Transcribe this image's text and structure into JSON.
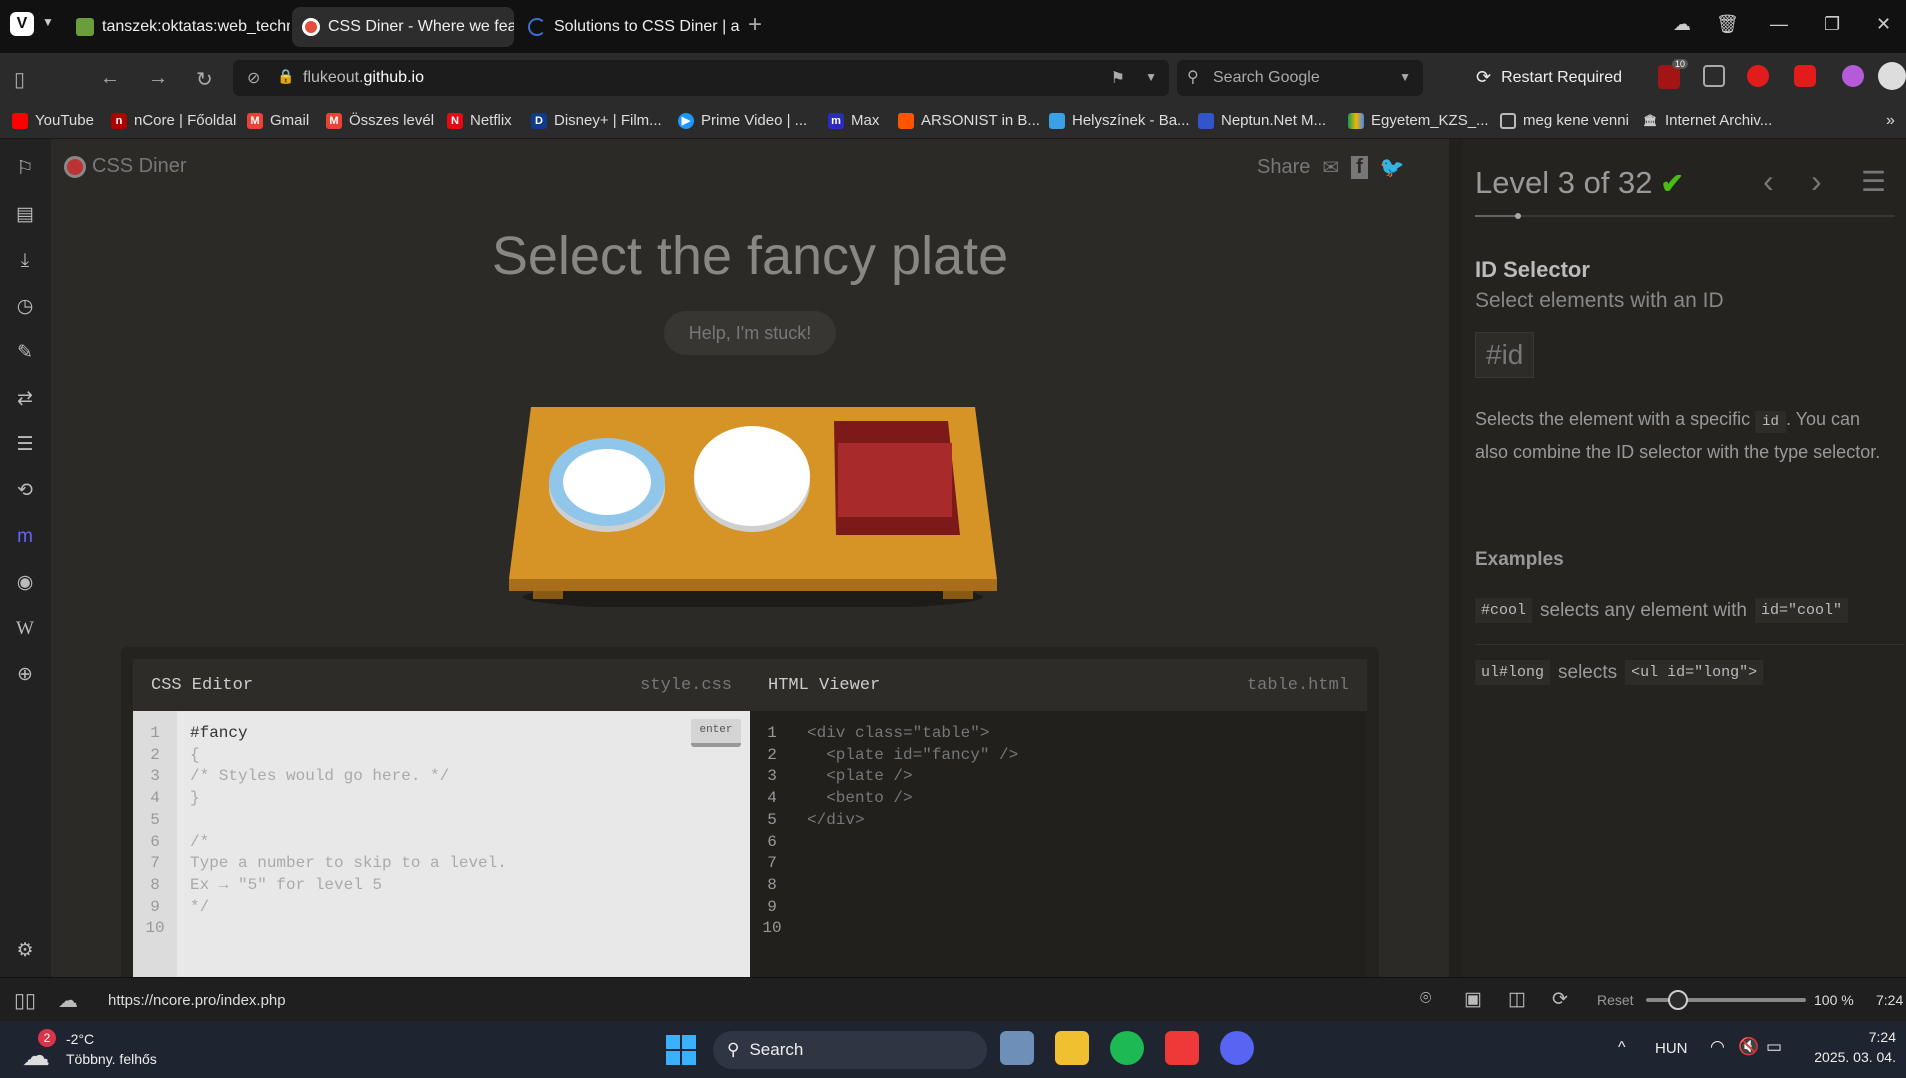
{
  "browser": {
    "tabs": [
      {
        "title": "tanszek:oktatas:web_technolo"
      },
      {
        "title": "CSS Diner - Where we feast"
      },
      {
        "title": "Solutions to CSS Diner | and"
      }
    ],
    "url_host": "flukeout.",
    "url_domain": "github.io",
    "search_placeholder": "Search Google",
    "restart_label": "Restart Required",
    "badge_count": "10",
    "bookmarks": [
      {
        "label": "YouTube",
        "color": "#ff0000"
      },
      {
        "label": "nCore | Főoldal",
        "color": "#b00000"
      },
      {
        "label": "Gmail",
        "color": "#ea4335"
      },
      {
        "label": "Összes levél",
        "color": "#ea4335"
      },
      {
        "label": "Netflix",
        "color": "#e50914"
      },
      {
        "label": "Disney+ | Film...",
        "color": "#0f3b8c"
      },
      {
        "label": "Prime Video | ...",
        "color": "#1a98ff"
      },
      {
        "label": "Max",
        "color": "#2b2bbf"
      },
      {
        "label": "ARSONIST in B...",
        "color": "#ff5500"
      },
      {
        "label": "Helyszínek - Ba...",
        "color": "#3aa0e8"
      },
      {
        "label": "Neptun.Net M...",
        "color": "#3355cc"
      },
      {
        "label": "Egyetem_KZS_...",
        "color": "#f4b400"
      },
      {
        "label": "meg kene venni",
        "color": "#888888"
      },
      {
        "label": "Internet Archiv...",
        "color": "#cccccc"
      }
    ]
  },
  "game": {
    "logo": "CSS Diner",
    "share_label": "Share",
    "instruction": "Select the fancy plate",
    "help_button": "Help, I'm stuck!",
    "css_editor_title": "CSS Editor",
    "css_editor_file": "style.css",
    "enter_label": "enter",
    "css_lines": [
      "#fancy",
      "{",
      "/* Styles would go here. */",
      "}",
      "",
      "/*",
      "Type a number to skip to a level.",
      "Ex → \"5\" for level 5",
      "*/",
      ""
    ],
    "css_line_numbers": [
      "1",
      "2",
      "3",
      "4",
      "5",
      "6",
      "7",
      "8",
      "9",
      "10"
    ],
    "html_viewer_title": "HTML Viewer",
    "html_viewer_file": "table.html",
    "html_lines": [
      "<div class=\"table\">",
      "  <plate id=\"fancy\" />",
      "  <plate />",
      "  <bento />",
      "</div>",
      "",
      "",
      "",
      "",
      ""
    ],
    "html_line_numbers": [
      "1",
      "2",
      "3",
      "4",
      "5",
      "6",
      "7",
      "8",
      "9",
      "10"
    ]
  },
  "level": {
    "title": "Level 3 of 32",
    "selector_name": "ID Selector",
    "selector_subtitle": "Select elements with an ID",
    "syntax": "#id",
    "desc_part1": "Selects the element with a specific ",
    "desc_code": "id",
    "desc_part2": ". You can also combine the ID selector with the type selector.",
    "examples_title": "Examples",
    "ex1_code": "#cool",
    "ex1_text": "selects any element with",
    "ex1_code2": "id=\"cool\"",
    "ex2_code": "ul#long",
    "ex2_text": "selects",
    "ex2_code2": "<ul id=\"long\">"
  },
  "status": {
    "link_url": "https://ncore.pro/index.php",
    "reset_label": "Reset",
    "zoom": "100 %",
    "zoom_fraction": 0.2,
    "time": "7:24"
  },
  "taskbar": {
    "weather_temp": "-2°C",
    "weather_desc": "Több­ny. felhős",
    "weather_badge": "2",
    "search_label": "Search",
    "lang": "HUN",
    "clock_time": "7:24",
    "clock_date": "2025. 03. 04."
  }
}
